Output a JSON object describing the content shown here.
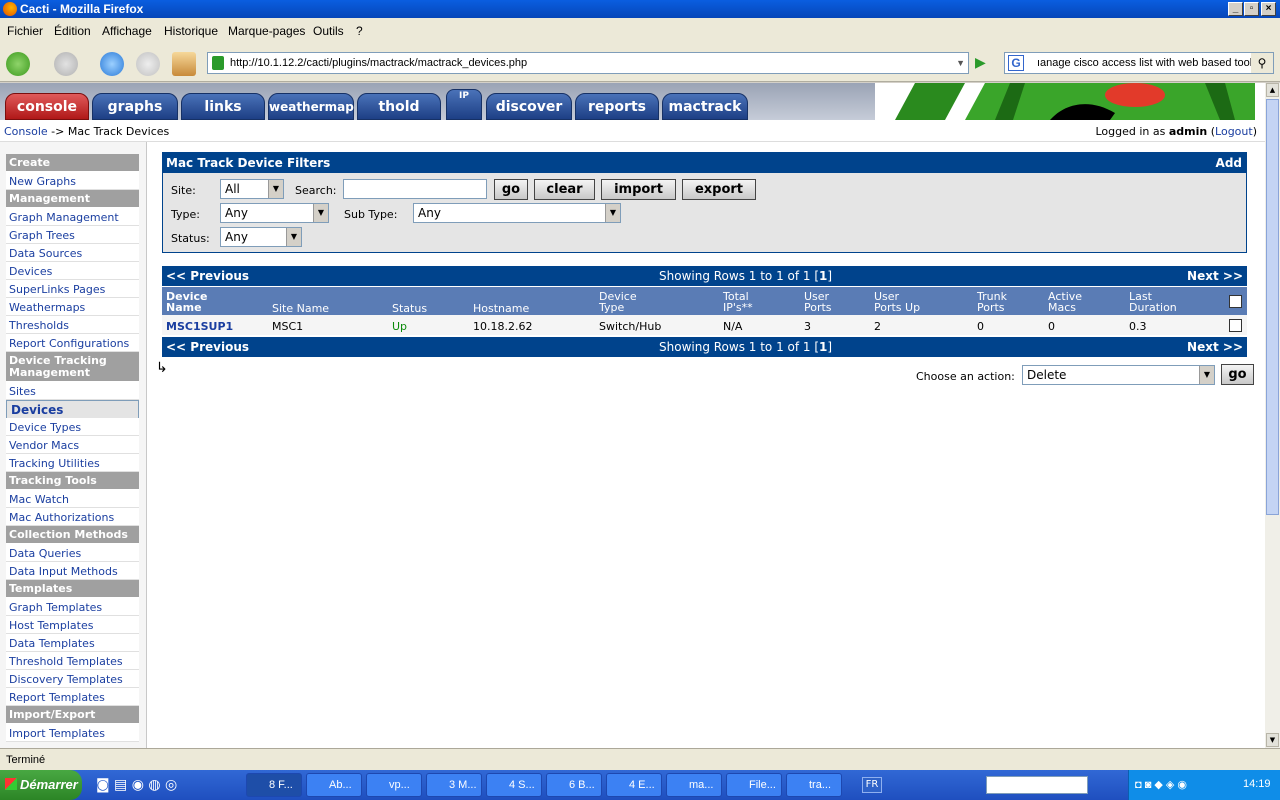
{
  "window": {
    "title": "Cacti - Mozilla Firefox"
  },
  "menu": [
    "Fichier",
    "Édition",
    "Affichage",
    "Historique",
    "Marque-pages",
    "Outils",
    "?"
  ],
  "browser": {
    "url": "http://10.1.12.2/cacti/plugins/mactrack/mactrack_devices.php",
    "search_value": "ıanage cisco access list with web based tool",
    "status": "Terminé"
  },
  "tabs": [
    "console",
    "graphs",
    "links",
    "weathermap",
    "thold",
    "IP",
    "discover",
    "reports",
    "mactrack"
  ],
  "breadcrumb": {
    "home": "Console",
    "sep": " -> ",
    "current": "Mac Track Devices",
    "logged_prefix": "Logged in as ",
    "user": "admin",
    "logout": "Logout"
  },
  "sidebar": [
    {
      "type": "head",
      "label": "Create"
    },
    {
      "type": "item",
      "label": "New Graphs"
    },
    {
      "type": "head",
      "label": "Management"
    },
    {
      "type": "item",
      "label": "Graph Management"
    },
    {
      "type": "item",
      "label": "Graph Trees"
    },
    {
      "type": "item",
      "label": "Data Sources"
    },
    {
      "type": "item",
      "label": "Devices"
    },
    {
      "type": "item",
      "label": "SuperLinks Pages"
    },
    {
      "type": "item",
      "label": "Weathermaps"
    },
    {
      "type": "item",
      "label": "Thresholds"
    },
    {
      "type": "item",
      "label": "Report Configurations"
    },
    {
      "type": "head2",
      "label": "Device Tracking Management"
    },
    {
      "type": "item",
      "label": "Sites"
    },
    {
      "type": "item",
      "label": "Devices",
      "selected": true
    },
    {
      "type": "item",
      "label": "Device Types"
    },
    {
      "type": "item",
      "label": "Vendor Macs"
    },
    {
      "type": "item",
      "label": "Tracking Utilities"
    },
    {
      "type": "head",
      "label": "Tracking Tools"
    },
    {
      "type": "item",
      "label": "Mac Watch"
    },
    {
      "type": "item",
      "label": "Mac Authorizations"
    },
    {
      "type": "head",
      "label": "Collection Methods"
    },
    {
      "type": "item",
      "label": "Data Queries"
    },
    {
      "type": "item",
      "label": "Data Input Methods"
    },
    {
      "type": "head",
      "label": "Templates"
    },
    {
      "type": "item",
      "label": "Graph Templates"
    },
    {
      "type": "item",
      "label": "Host Templates"
    },
    {
      "type": "item",
      "label": "Data Templates"
    },
    {
      "type": "item",
      "label": "Threshold Templates"
    },
    {
      "type": "item",
      "label": "Discovery Templates"
    },
    {
      "type": "item",
      "label": "Report Templates"
    },
    {
      "type": "head",
      "label": "Import/Export"
    },
    {
      "type": "item",
      "label": "Import Templates"
    }
  ],
  "filters": {
    "title": "Mac Track Device Filters",
    "add": "Add",
    "site_label": "Site:",
    "site_value": "All",
    "search_label": "Search:",
    "search_value": "",
    "go": "go",
    "clear": "clear",
    "import": "import",
    "export": "export",
    "type_label": "Type:",
    "type_value": "Any",
    "subtype_label": "Sub Type:",
    "subtype_value": "Any",
    "status_label": "Status:",
    "status_value": "Any"
  },
  "pager": {
    "previous": "<< Previous",
    "showing": "Showing Rows 1 to 1 of 1 [",
    "page": "1",
    "close": "]",
    "next": "Next >>"
  },
  "table": {
    "headers": [
      [
        "Device",
        "Name"
      ],
      [
        "Site Name",
        ""
      ],
      [
        "Status",
        ""
      ],
      [
        "Hostname",
        ""
      ],
      [
        "Device",
        "Type"
      ],
      [
        "Total",
        "IP's**"
      ],
      [
        "User",
        "Ports"
      ],
      [
        "User",
        "Ports Up"
      ],
      [
        "Trunk",
        "Ports"
      ],
      [
        "Active",
        "Macs"
      ],
      [
        "Last",
        "Duration"
      ]
    ],
    "rows": [
      [
        "MSC1SUP1",
        "MSC1",
        "Up",
        "10.18.2.62",
        "Switch/Hub",
        "N/A",
        "3",
        "2",
        "0",
        "0",
        "0.3"
      ]
    ]
  },
  "action": {
    "label": "Choose an action:",
    "value": "Delete",
    "go": "go"
  },
  "taskbar": {
    "start": "Démarrer",
    "tasks": [
      "8 F...",
      "Ab...",
      "vp...",
      "3 M...",
      "4 S...",
      "6 B...",
      "4 E...",
      "ma...",
      "File...",
      "tra..."
    ],
    "lang": "FR",
    "clock": "14:19"
  },
  "colors": {
    "accent": "#00438c",
    "status_up": "#0a8a0a",
    "link": "#1a3ea0"
  }
}
